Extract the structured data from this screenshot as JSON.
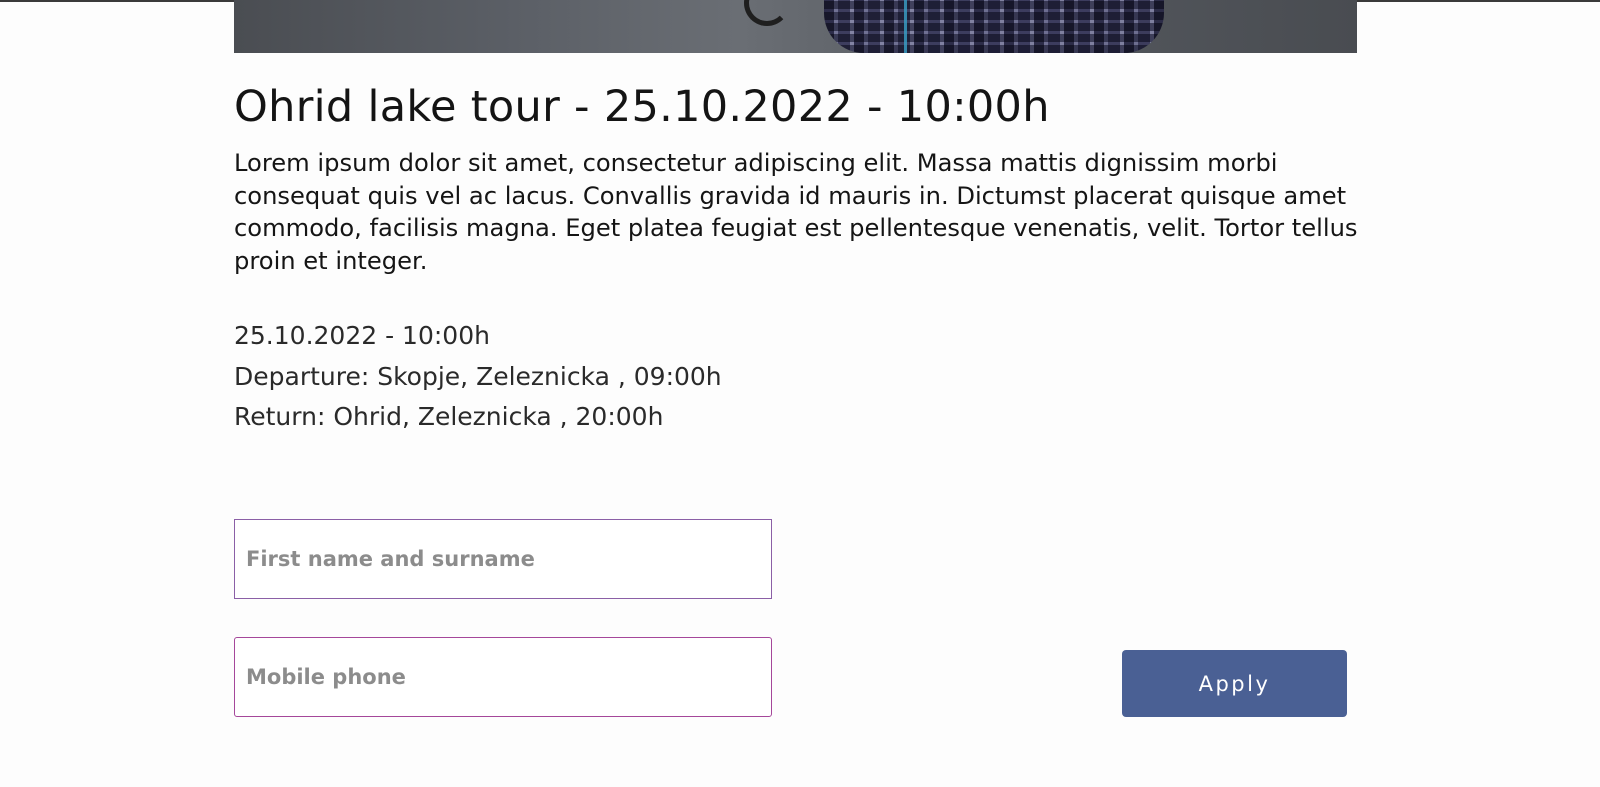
{
  "hero": {
    "image_alt": ""
  },
  "tour": {
    "title": "Ohrid lake tour - 25.10.2022 - 10:00h",
    "description": "Lorem ipsum dolor sit amet, consectetur adipiscing elit. Massa mattis dignissim morbi consequat quis vel ac lacus. Convallis gravida id mauris in. Dictumst placerat quisque amet commodo, facilisis magna. Eget platea feugiat est pellentesque venenatis, velit. Tortor tellus proin et integer.",
    "date": "25.10.2022 - 10:00h",
    "departure": "Departure: Skopje, Zeleznicka , 09:00h",
    "return": "Return: Ohrid, Zeleznicka , 20:00h"
  },
  "form": {
    "name_placeholder": "First name and surname",
    "name_value": "",
    "phone_placeholder": "Mobile phone",
    "phone_value": "",
    "apply_label": "Apply"
  },
  "colors": {
    "accent_button": "#4a6094",
    "input_border": "#9a6ab0",
    "text": "#151515"
  }
}
